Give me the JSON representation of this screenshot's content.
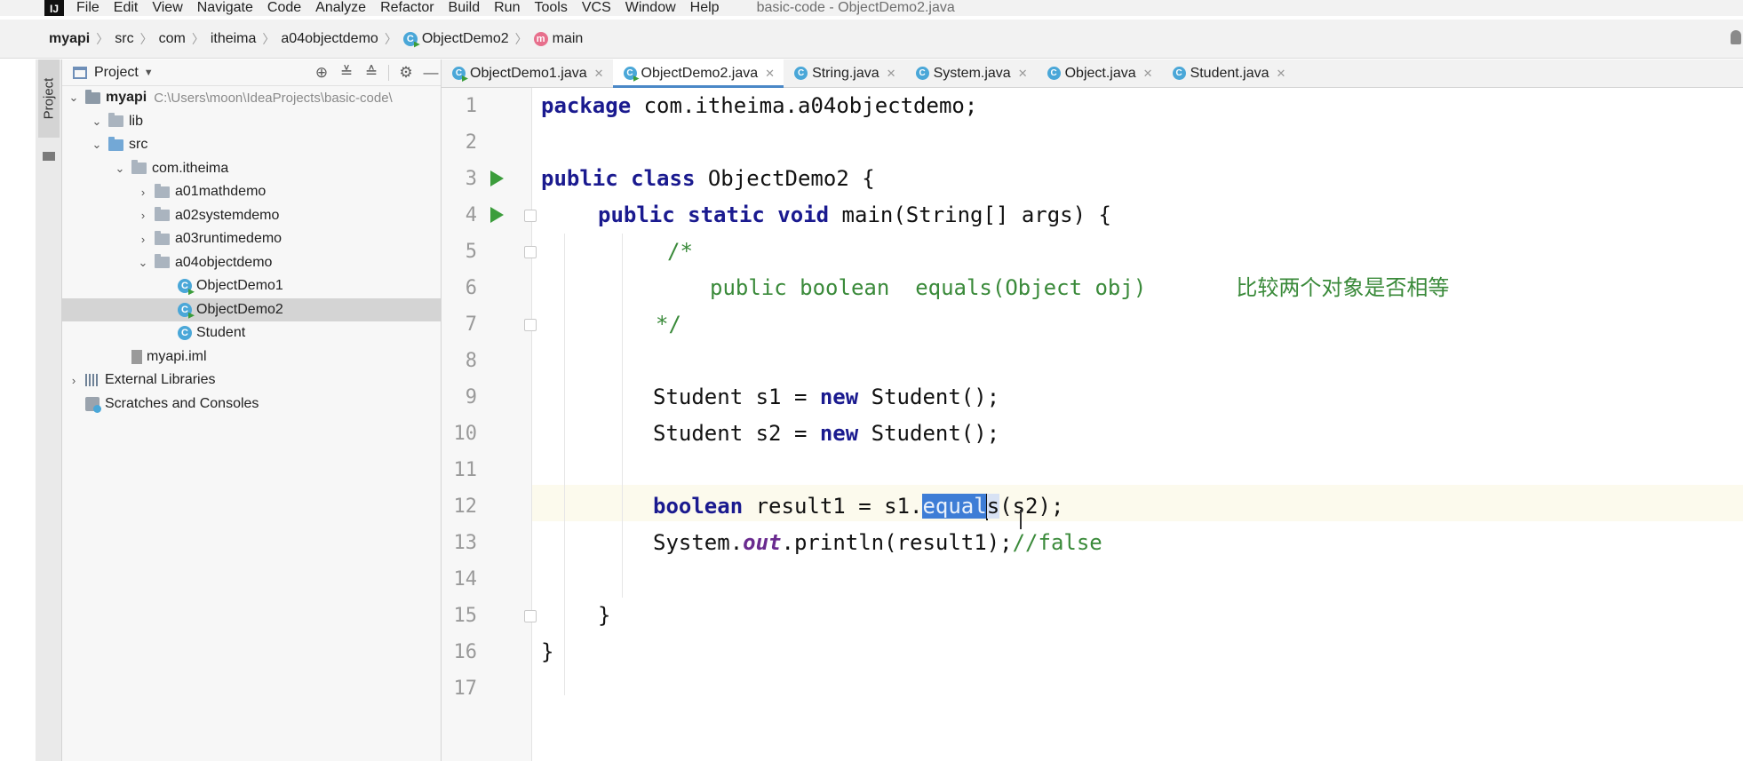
{
  "window": {
    "title": "basic-code - ObjectDemo2.java"
  },
  "menu": [
    "File",
    "Edit",
    "View",
    "Navigate",
    "Code",
    "Analyze",
    "Refactor",
    "Build",
    "Run",
    "Tools",
    "VCS",
    "Window",
    "Help"
  ],
  "breadcrumb": [
    "myapi",
    "src",
    "com",
    "itheima",
    "a04objectdemo",
    "ObjectDemo2",
    "main"
  ],
  "project_panel": {
    "strip_label": "Project",
    "title": "Project",
    "tree": [
      {
        "label": "myapi",
        "path": "C:\\Users\\moon\\IdeaProjects\\basic-code\\",
        "type": "module",
        "expanded": true
      },
      {
        "label": "lib",
        "type": "folder",
        "expanded": true
      },
      {
        "label": "src",
        "type": "src",
        "expanded": true
      },
      {
        "label": "com.itheima",
        "type": "package",
        "expanded": true
      },
      {
        "label": "a01mathdemo",
        "type": "package",
        "expanded": false
      },
      {
        "label": "a02systemdemo",
        "type": "package",
        "expanded": false
      },
      {
        "label": "a03runtimedemo",
        "type": "package",
        "expanded": false
      },
      {
        "label": "a04objectdemo",
        "type": "package",
        "expanded": true
      },
      {
        "label": "ObjectDemo1",
        "type": "class-run"
      },
      {
        "label": "ObjectDemo2",
        "type": "class-run",
        "selected": true
      },
      {
        "label": "Student",
        "type": "class"
      },
      {
        "label": "myapi.iml",
        "type": "file"
      },
      {
        "label": "External Libraries",
        "type": "libraries",
        "expanded": false
      },
      {
        "label": "Scratches and Consoles",
        "type": "scratches"
      }
    ]
  },
  "tabs": [
    {
      "label": "ObjectDemo1.java",
      "active": false
    },
    {
      "label": "ObjectDemo2.java",
      "active": true
    },
    {
      "label": "String.java",
      "active": false
    },
    {
      "label": "System.java",
      "active": false
    },
    {
      "label": "Object.java",
      "active": false
    },
    {
      "label": "Student.java",
      "active": false
    }
  ],
  "editor": {
    "line_numbers": [
      "1",
      "2",
      "3",
      "4",
      "5",
      "6",
      "7",
      "8",
      "9",
      "10",
      "11",
      "12",
      "13",
      "14",
      "15",
      "16",
      "17"
    ],
    "current_line": 12,
    "code": {
      "l1_kw": "package",
      "l1_rest": " com.itheima.a04objectdemo;",
      "l3_kw": "public class",
      "l3_rest": " ObjectDemo2 {",
      "l4_kw": "public static void",
      "l4_rest": " main(String[] args) {",
      "l5": "/*",
      "l6": "public boolean  equals(Object obj)       比较两个对象是否相等",
      "l7": "*/",
      "l9_a": "Student s1 = ",
      "l9_kw": "new",
      "l9_b": " Student();",
      "l10_a": "Student s2 = ",
      "l10_kw": "new",
      "l10_b": " Student();",
      "l12_kw": "boolean",
      "l12_a": " result1 = s1.",
      "l12_sel": "equal",
      "l12_tail": "s",
      "l12_b": "(s2);",
      "l13_a": "System.",
      "l13_field": "out",
      "l13_b": ".println(result1);",
      "l13_cm": "//false",
      "l15": "}",
      "l16": "}"
    }
  }
}
